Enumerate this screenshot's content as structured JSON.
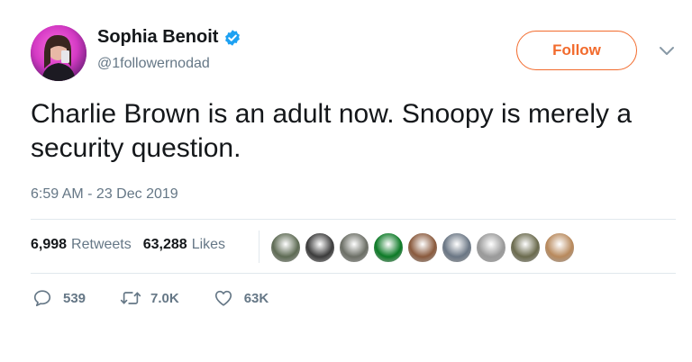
{
  "user": {
    "display_name": "Sophia Benoit",
    "handle": "@1followernodad",
    "verified": true,
    "avatar_icon": "profile-photo"
  },
  "follow_button": {
    "label": "Follow",
    "color": "#f26b2d"
  },
  "menu": {
    "icon": "chevron-down-icon"
  },
  "tweet": {
    "text": "Charlie Brown is an adult now. Snoopy is merely a security question.",
    "timestamp": "6:59 AM - 23 Dec 2019"
  },
  "stats": {
    "retweets": {
      "value": "6,998",
      "label": "Retweets"
    },
    "likes": {
      "value": "63,288",
      "label": "Likes"
    }
  },
  "likers": [
    {
      "color": "#5e6b54"
    },
    {
      "color": "#3b3b3b"
    },
    {
      "color": "#6c6f66"
    },
    {
      "color": "#0c7a26"
    },
    {
      "color": "#8a5a3d"
    },
    {
      "color": "#6a7684"
    },
    {
      "color": "#9a9a9a"
    },
    {
      "color": "#6b6b4e"
    },
    {
      "color": "#b8895c"
    }
  ],
  "actions": {
    "reply": {
      "icon": "reply-icon",
      "count": "539"
    },
    "retweet": {
      "icon": "retweet-icon",
      "count": "7.0K"
    },
    "like": {
      "icon": "heart-icon",
      "count": "63K"
    }
  },
  "colors": {
    "text_primary": "#14171a",
    "text_secondary": "#657786",
    "verified_blue": "#1da1f2",
    "divider": "#e1e8ed"
  }
}
